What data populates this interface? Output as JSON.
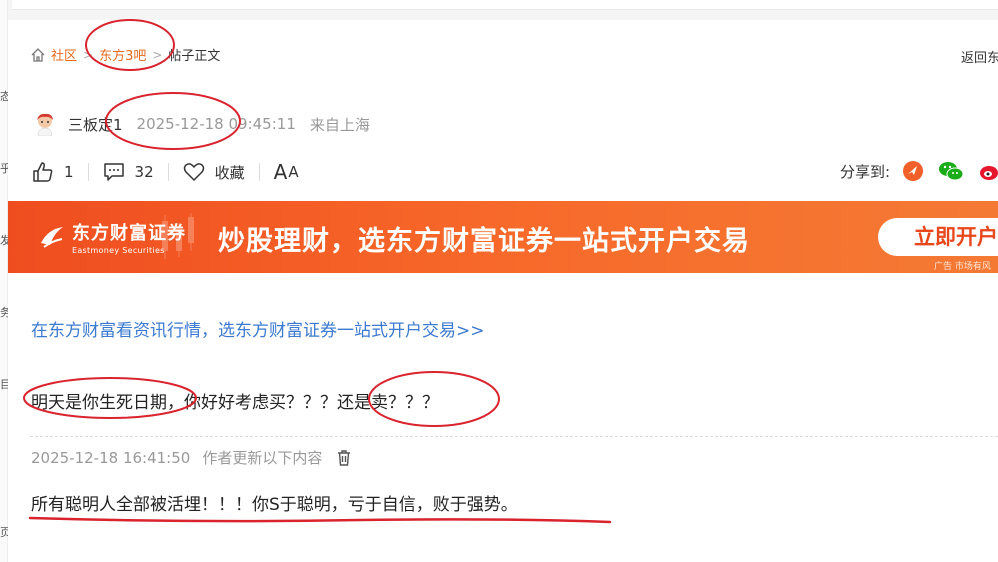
{
  "breadcrumb": {
    "home": "社区",
    "forum": "东方3吧",
    "current": "帖子正文",
    "back": "返回东"
  },
  "author": {
    "name": "三板定1",
    "time": "2025-12-18 09:45:11",
    "location": "来自上海"
  },
  "actions": {
    "like_count": "1",
    "comment_count": "32",
    "favorite_label": "收藏",
    "font_large": "A",
    "font_small": "A",
    "share_label": "分享到:"
  },
  "banner": {
    "logo_name": "东方财富证券",
    "logo_en": "Eastmoney Securities",
    "slogan": "炒股理财，选东方财富证券一站式开户交易",
    "cta": "立即开户",
    "ad_tag": "广告 市场有风"
  },
  "content": {
    "promo_link": "在东方财富看资讯行情，选东方财富证券一站式开户交易>>",
    "body": "明天是你生死日期，你好好考虑买？？？还是卖？？？",
    "update_time": "2025-12-18 16:41:50",
    "update_label": "作者更新以下内容",
    "update_body": "所有聪明人全部被活埋！！！你S于聪明，亏于自信，败于强势。"
  },
  "left_edge": [
    "态",
    "乎",
    "发",
    "务",
    "目",
    "页"
  ],
  "colors": {
    "accent_orange": "#e56a1f",
    "link_blue": "#3a7ad0",
    "banner_red": "#ef4d1f",
    "annotation_red": "#d9232d"
  },
  "icons": [
    "home-icon",
    "thumbs-up-icon",
    "comment-icon",
    "heart-icon",
    "share-toutiao-icon",
    "share-wechat-icon",
    "share-weibo-icon",
    "trash-icon"
  ]
}
